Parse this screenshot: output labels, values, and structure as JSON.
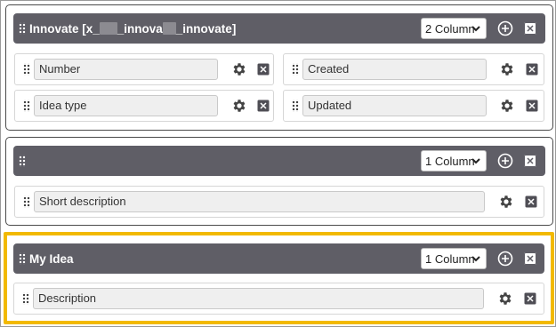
{
  "colors": {
    "header_bg": "#5f5e66",
    "highlight": "#f2b900",
    "field_bg": "#efefef"
  },
  "sections": [
    {
      "title_prefix": "Innovate [x_",
      "title_mid1": "_innova",
      "title_mid2": "_innovate]",
      "columns": "2 Column",
      "fields": [
        "Number",
        "Created",
        "Idea type",
        "Updated"
      ]
    },
    {
      "title": "",
      "columns": "1 Column",
      "fields": [
        "Short description"
      ]
    },
    {
      "title": "My Idea",
      "columns": "1 Column",
      "fields": [
        "Description"
      ]
    }
  ],
  "icons": {
    "grip": "drag-handle-icon",
    "add": "plus-circle-icon",
    "remove": "close-box-icon",
    "settings": "gear-icon",
    "dropdown": "chevron-down-icon"
  }
}
